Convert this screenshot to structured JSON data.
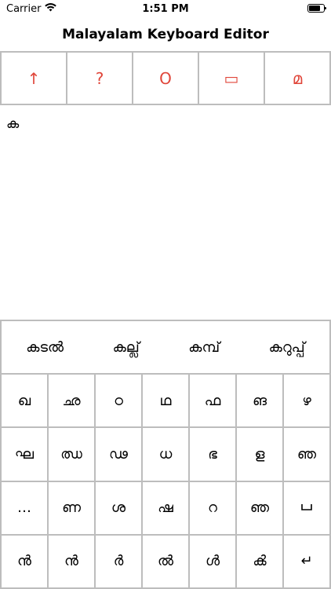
{
  "status_bar": {
    "carrier": "Carrier",
    "time": "1:51 PM",
    "wifi_icon": "wifi-icon",
    "battery_icon": "battery-icon"
  },
  "nav": {
    "title": "Malayalam Keyboard Editor"
  },
  "toolbar": {
    "accent_color": "#e0463a",
    "buttons": [
      {
        "name": "shift-up-arrow",
        "label": "↑"
      },
      {
        "name": "help",
        "label": "?"
      },
      {
        "name": "circle",
        "label": "O"
      },
      {
        "name": "rounded-rect",
        "label": "▭"
      },
      {
        "name": "malayalam-ma",
        "label": "മ"
      }
    ]
  },
  "editor": {
    "text": "ക"
  },
  "suggestions": [
    "കടൽ",
    "കല്ല്",
    "കമ്പ്",
    "കറുപ്പ്"
  ],
  "keyboard": {
    "rows": [
      [
        "ഖ",
        "ഛ",
        "ഠ",
        "ഥ",
        "ഫ",
        "ങ",
        "ഴ"
      ],
      [
        "ഘ",
        "ഝ",
        "ഢ",
        "ധ",
        "ഭ",
        "ള",
        "ഞ"
      ],
      [
        "…",
        "ണ",
        "ശ",
        "ഷ",
        "റ",
        "ഞ",
        "␣"
      ],
      [
        "ൻ",
        "ൻ",
        "ർ",
        "ൽ",
        "ൾ",
        "ൿ",
        "↵"
      ]
    ]
  }
}
